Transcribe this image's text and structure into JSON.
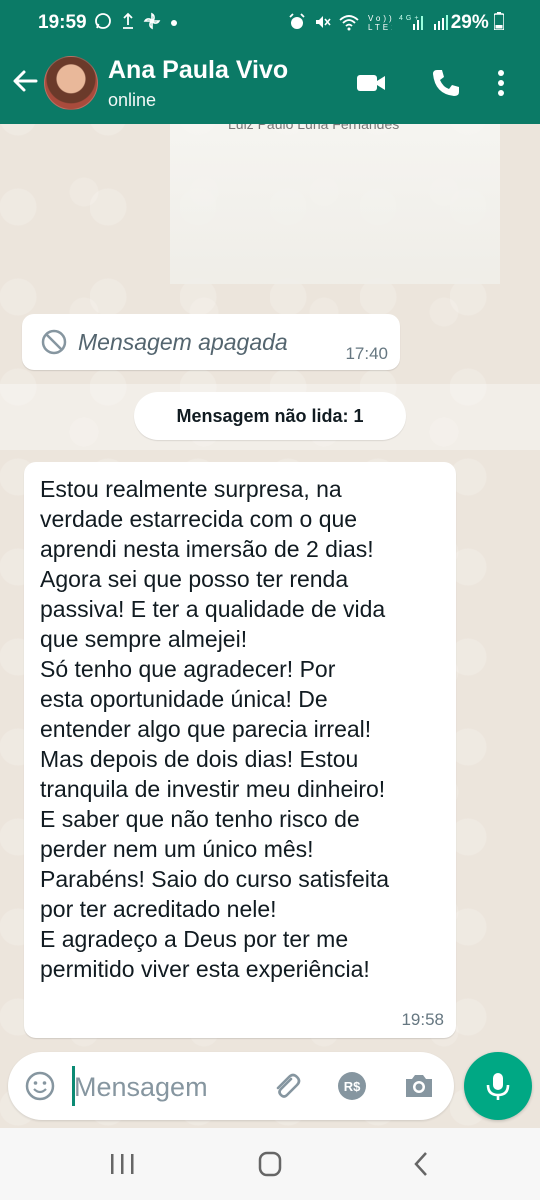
{
  "status_bar": {
    "time": "19:59",
    "left_icons": "whatsapp-icon upload-icon pinwheel-icon dot",
    "right_icons": "alarm-icon mute-icon wifi-icon volte-icon signal-icon signal-icon",
    "battery": "29%"
  },
  "header": {
    "contact_name": "Ana Paula Vivo",
    "contact_status": "online",
    "icons": [
      "back-arrow-icon",
      "video-call-icon",
      "phone-icon",
      "more-vert-icon"
    ],
    "color": "#0b7a66"
  },
  "faded_image": {
    "caption_fragment": "Luiz Paulo Luna Fernandes"
  },
  "deleted_message": {
    "text": "Mensagem apagada",
    "time": "17:40",
    "icon": "block-icon"
  },
  "unread_banner": {
    "text": "Mensagem não lida: 1"
  },
  "message": {
    "text": "Estou realmente surpresa, na\nverdade estarrecida com o que\naprendi nesta imersão de 2 dias!\nAgora sei que posso ter renda\npassiva! E ter a qualidade de vida\nque sempre almejei!\nSó tenho que agradecer! Por\nesta oportunidade única! De\nentender algo que parecia irreal!\nMas depois de dois dias! Estou\ntranquila de investir meu dinheiro!\nE saber que não tenho risco de\nperder nem um único mês!\nParabéns! Saio do curso satisfeita\npor ter acreditado nele!\nE agradeço a Deus por ter me\npermitido viver esta experiência!",
    "time": "19:58"
  },
  "composer": {
    "placeholder": "Mensagem",
    "icons": [
      "emoji-icon",
      "attach-icon",
      "payment-icon",
      "camera-icon"
    ],
    "mic_icon": "mic-icon",
    "accent": "#00a884"
  },
  "nav_bar": {
    "icons": [
      "recents-icon",
      "home-icon",
      "back-icon"
    ]
  }
}
